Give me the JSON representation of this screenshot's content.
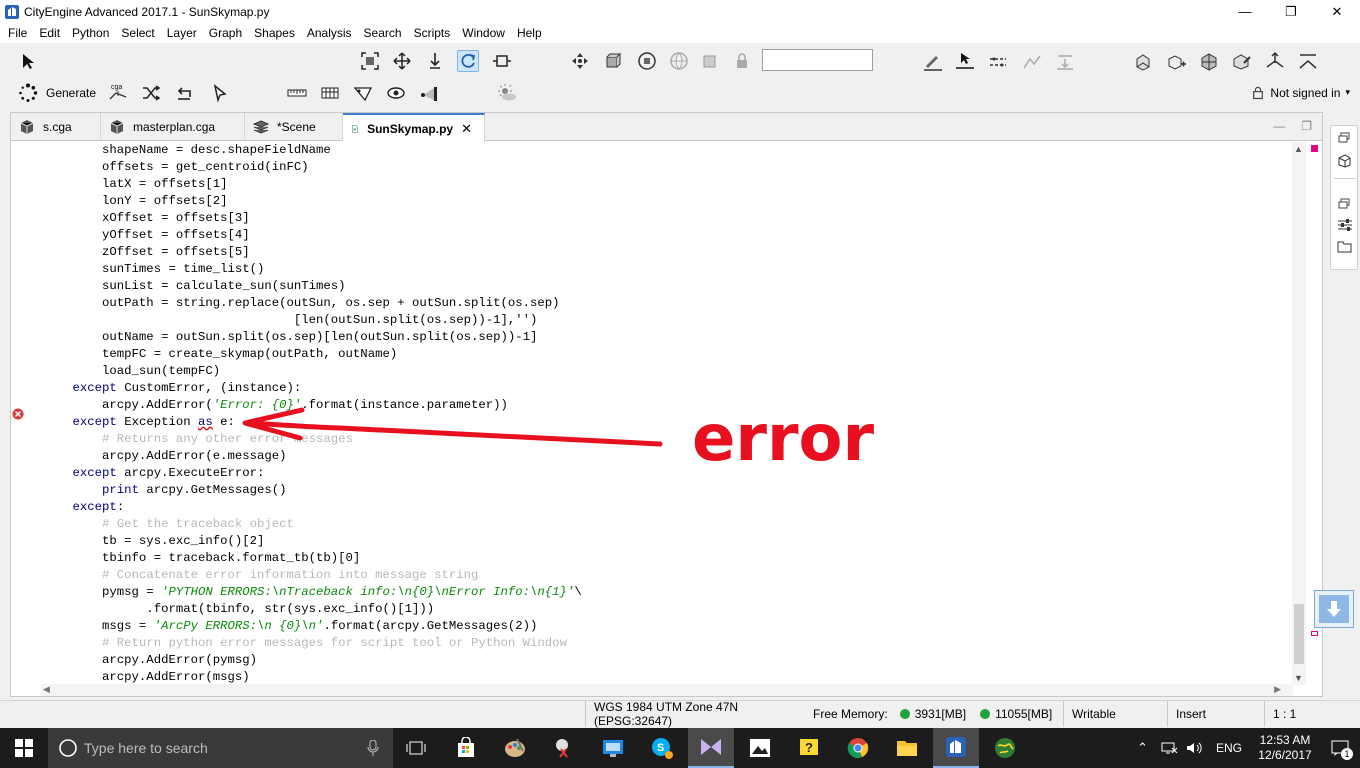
{
  "window": {
    "title": "CityEngine Advanced 2017.1 - SunSkymap.py",
    "minimize": "—",
    "maximize": "❐",
    "close": "✕"
  },
  "menu": [
    "File",
    "Edit",
    "Python",
    "Select",
    "Layer",
    "Graph",
    "Shapes",
    "Analysis",
    "Search",
    "Scripts",
    "Window",
    "Help"
  ],
  "toolbar": {
    "generate_label": "Generate",
    "cga_label": "cga",
    "search_value": "",
    "signin_label": "Not signed in",
    "signin_caret": "▾"
  },
  "tabs": [
    {
      "label": "s.cga",
      "icon": "cga-file-icon",
      "active": false
    },
    {
      "label": "masterplan.cga",
      "icon": "cga-file-icon",
      "active": false
    },
    {
      "label": "*Scene",
      "icon": "scene-layers-icon",
      "active": false
    },
    {
      "label": "SunSkymap.py",
      "icon": "python-file-icon",
      "active": true,
      "close": "✕"
    }
  ],
  "tab_controls": {
    "minimize": "—",
    "maximize": "❐"
  },
  "code_lines": [
    [
      {
        "t": "        shapeName = desc.shapeFieldName"
      }
    ],
    [
      {
        "t": "        offsets = get_centroid(inFC)"
      }
    ],
    [
      {
        "t": "        latX = offsets[1]"
      }
    ],
    [
      {
        "t": "        lonY = offsets[2]"
      }
    ],
    [
      {
        "t": "        xOffset = offsets[3]"
      }
    ],
    [
      {
        "t": "        yOffset = offsets[4]"
      }
    ],
    [
      {
        "t": "        zOffset = offsets[5]"
      }
    ],
    [
      {
        "t": "        sunTimes = time_list()"
      }
    ],
    [
      {
        "t": "        sunList = calculate_sun(sunTimes)"
      }
    ],
    [
      {
        "t": "        outPath = string.replace(outSun, os.sep + outSun.split(os.sep)"
      }
    ],
    [
      {
        "t": "                                  [len(outSun.split(os.sep))-1],'')"
      }
    ],
    [
      {
        "t": "        outName = outSun.split(os.sep)[len(outSun.split(os.sep))-1]"
      }
    ],
    [
      {
        "t": "        tempFC = create_skymap(outPath, outName)"
      }
    ],
    [
      {
        "t": "        load_sun(tempFC)"
      }
    ],
    [
      {
        "t": "    "
      },
      {
        "t": "except",
        "c": "kw"
      },
      {
        "t": " CustomError, (instance):"
      }
    ],
    [
      {
        "t": "        arcpy.AddError("
      },
      {
        "t": "'Error: {0}'",
        "c": "str"
      },
      {
        "t": ".format(instance.parameter))"
      }
    ],
    [
      {
        "t": "    "
      },
      {
        "t": "except",
        "c": "kw"
      },
      {
        "t": " Exception "
      },
      {
        "t": "as",
        "c": "kw squig"
      },
      {
        "t": " e:"
      }
    ],
    [
      {
        "t": "        "
      },
      {
        "t": "# Returns any other error messages",
        "c": "cmt"
      }
    ],
    [
      {
        "t": "        arcpy.AddError(e.message)"
      }
    ],
    [
      {
        "t": "    "
      },
      {
        "t": "except",
        "c": "kw"
      },
      {
        "t": " arcpy.ExecuteError:"
      }
    ],
    [
      {
        "t": "        "
      },
      {
        "t": "print",
        "c": "kw"
      },
      {
        "t": " arcpy.GetMessages()"
      }
    ],
    [
      {
        "t": "    "
      },
      {
        "t": "except",
        "c": "kw"
      },
      {
        "t": ":"
      }
    ],
    [
      {
        "t": "        "
      },
      {
        "t": "# Get the traceback object",
        "c": "cmt"
      }
    ],
    [
      {
        "t": "        tb = sys.exc_info()[2]"
      }
    ],
    [
      {
        "t": "        tbinfo = traceback.format_tb(tb)[0]"
      }
    ],
    [
      {
        "t": "        "
      },
      {
        "t": "# Concatenate error information into message string",
        "c": "cmt"
      }
    ],
    [
      {
        "t": "        pymsg = "
      },
      {
        "t": "'PYTHON ERRORS:\\nTraceback info:\\n{0}\\nError Info:\\n{1}'",
        "c": "str"
      },
      {
        "t": "\\"
      }
    ],
    [
      {
        "t": "              .format(tbinfo, str(sys.exc_info()[1]))"
      }
    ],
    [
      {
        "t": "        msgs = "
      },
      {
        "t": "'ArcPy ERRORS:\\n {0}\\n'",
        "c": "str"
      },
      {
        "t": ".format(arcpy.GetMessages(2))"
      }
    ],
    [
      {
        "t": "        "
      },
      {
        "t": "# Return python error messages for script tool or Python Window",
        "c": "cmt"
      }
    ],
    [
      {
        "t": "        arcpy.AddError(pymsg)"
      }
    ],
    [
      {
        "t": "        arcpy.AddError(msgs)"
      }
    ]
  ],
  "error_line_index": 16,
  "annotation_text": "error",
  "status": {
    "crs": "WGS 1984 UTM Zone 47N (EPSG:32647)",
    "free_memory_label": "Free Memory:",
    "mem1": "3931[MB]",
    "mem2": "11055[MB]",
    "writable": "Writable",
    "insert": "Insert",
    "position": "1 : 1"
  },
  "taskbar": {
    "search_placeholder": "Type here to search",
    "lang": "ENG",
    "time": "12:53 AM",
    "date": "12/6/2017",
    "notification_count": "1"
  },
  "colors": {
    "accent": "#3c7fd1",
    "keyword": "#000080",
    "string": "#0a8a0a",
    "comment": "#b8b8b8",
    "annotation": "#e8101e",
    "memory_ok": "#22a33a"
  }
}
